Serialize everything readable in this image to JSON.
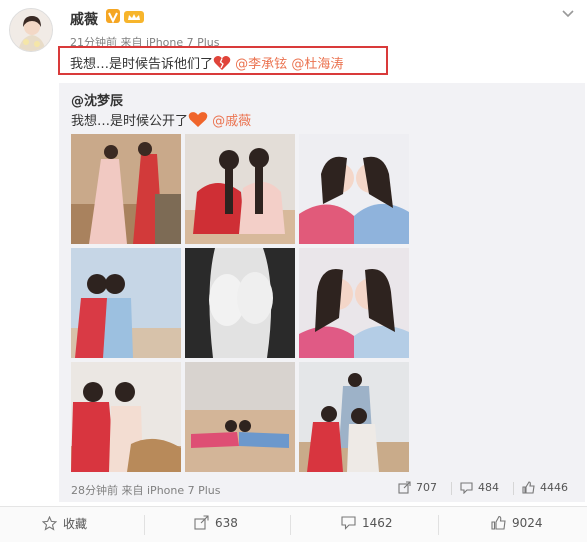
{
  "post": {
    "author": "戚薇",
    "time": "21分钟前",
    "source_prefix": "来自",
    "device": "iPhone 7 Plus",
    "text_main": "我想…是时候告诉他们了",
    "mentions": [
      "@李承铉",
      "@杜海涛"
    ],
    "badge_color": "#f5a623",
    "highlight_color": "#d93a3a",
    "mention_color": "#eb7350"
  },
  "repost": {
    "author": "@沈梦辰",
    "text_main": "我想…是时候公开了",
    "mention": "@戚薇",
    "time": "28分钟前",
    "source_prefix": "来自",
    "device": "iPhone 7 Plus",
    "repost_count": "707",
    "comment_count": "484",
    "like_count": "4446",
    "images": [
      {
        "name": "photo-1"
      },
      {
        "name": "photo-2"
      },
      {
        "name": "photo-3"
      },
      {
        "name": "photo-4"
      },
      {
        "name": "photo-5"
      },
      {
        "name": "photo-6"
      },
      {
        "name": "photo-7"
      },
      {
        "name": "photo-8"
      },
      {
        "name": "photo-9"
      }
    ]
  },
  "actions": {
    "favorite_label": "收藏",
    "repost_count": "638",
    "comment_count": "1462",
    "like_count": "9024"
  },
  "icons": {
    "verified": "v-badge-icon",
    "member": "crown-icon",
    "more": "chevron-down-icon",
    "favorite": "star-icon",
    "repost": "repost-icon",
    "comment": "comment-icon",
    "like": "thumbs-up-icon"
  }
}
